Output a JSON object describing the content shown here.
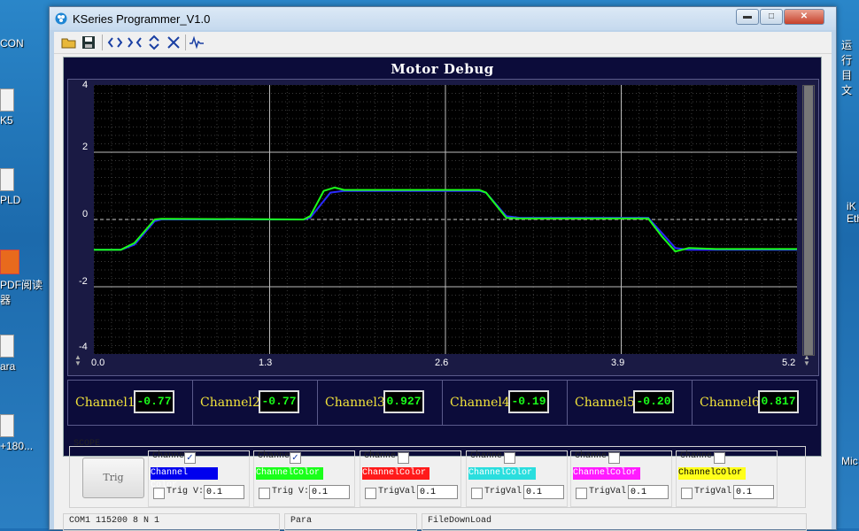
{
  "window": {
    "title": "KSeries Programmer_V1.0",
    "minimize": "▬",
    "maximize": "□",
    "close": "✕"
  },
  "toolbar": {
    "icons": [
      "open-folder-icon",
      "save-icon",
      "connect-icon",
      "disconnect-icon",
      "expand-icon",
      "close-x-icon",
      "waveform-icon"
    ]
  },
  "desktop": {
    "left_icons": [
      "CON",
      "K5",
      "PLD",
      "PDF阅读",
      "器",
      "ara",
      "+180..."
    ],
    "right_icons": [
      "运行",
      "目文",
      "iK",
      "Ethe",
      "Mic"
    ]
  },
  "panel": {
    "title": "Motor Debug"
  },
  "chart_data": {
    "type": "line",
    "ylim": [
      -4,
      4
    ],
    "xlim": [
      0.0,
      5.2
    ],
    "yticks": [
      "4",
      "2",
      "0",
      "-2",
      "-4"
    ],
    "xticks": [
      "0.0",
      "1.3",
      "2.6",
      "3.9",
      "5.2"
    ],
    "grid": true,
    "series": [
      {
        "color": "#2a2aff",
        "x": [
          0.0,
          0.2,
          0.3,
          0.45,
          0.5,
          1.55,
          1.6,
          1.75,
          1.85,
          2.85,
          2.9,
          3.05,
          3.15,
          4.1,
          4.2,
          4.3,
          4.4,
          4.6,
          5.2
        ],
        "y": [
          -0.9,
          -0.9,
          -0.75,
          -0.05,
          0.0,
          0.0,
          0.05,
          0.8,
          0.85,
          0.85,
          0.8,
          0.1,
          0.05,
          0.05,
          -0.4,
          -0.85,
          -0.9,
          -0.9,
          -0.9
        ]
      },
      {
        "color": "#1aff1a",
        "x": [
          0.0,
          0.2,
          0.3,
          0.45,
          0.5,
          1.55,
          1.6,
          1.7,
          1.78,
          1.85,
          2.85,
          2.9,
          3.05,
          3.15,
          4.1,
          4.2,
          4.3,
          4.4,
          4.6,
          5.2
        ],
        "y": [
          -0.9,
          -0.9,
          -0.7,
          0.0,
          0.02,
          0.0,
          0.1,
          0.85,
          0.95,
          0.88,
          0.88,
          0.8,
          0.05,
          0.03,
          0.03,
          -0.5,
          -0.95,
          -0.85,
          -0.88,
          -0.88
        ]
      }
    ]
  },
  "channels": [
    {
      "label": "Channel1",
      "value": "-0.77"
    },
    {
      "label": "Channel2",
      "value": "-0.77"
    },
    {
      "label": "Channel3",
      "value": "0.927"
    },
    {
      "label": "Channel4",
      "value": "-0.19"
    },
    {
      "label": "Channel5",
      "value": "-0.20"
    },
    {
      "label": "Channel6",
      "value": "0.817"
    }
  ],
  "scope": {
    "title": "SCOPE",
    "trig_button": "Trig",
    "channels": [
      {
        "caption": "Channe",
        "checked": true,
        "color_label": "Channel Color",
        "bg": "#0000ee",
        "fg": "#ffffff",
        "trig_label": "Trig V:",
        "trig_value": "0.1"
      },
      {
        "caption": "Channe",
        "checked": true,
        "color_label": "ChannelColor",
        "bg": "#1aff1a",
        "fg": "#ffffff",
        "trig_label": "Trig V:",
        "trig_value": "0.1"
      },
      {
        "caption": "Channe",
        "checked": false,
        "color_label": "ChannelColor",
        "bg": "#ff1a1a",
        "fg": "#ffffff",
        "trig_label": "TrigVal",
        "trig_value": "0.1"
      },
      {
        "caption": "Channe",
        "checked": false,
        "color_label": "ChannelColor",
        "bg": "#2adede",
        "fg": "#ffffff",
        "trig_label": "TrigVal",
        "trig_value": "0.1"
      },
      {
        "caption": "Channe",
        "checked": false,
        "color_label": "ChannelColor",
        "bg": "#ff1aff",
        "fg": "#ffffff",
        "trig_label": "TrigVal",
        "trig_value": "0.1"
      },
      {
        "caption": "Channe",
        "checked": false,
        "color_label": "ChannelCOlor",
        "bg": "#ffff1a",
        "fg": "#000000",
        "trig_label": "TrigVal",
        "trig_value": "0.1"
      }
    ]
  },
  "status": {
    "port": "COM1  115200  8  N  1",
    "para": "Para",
    "download": "FileDownLoad"
  }
}
